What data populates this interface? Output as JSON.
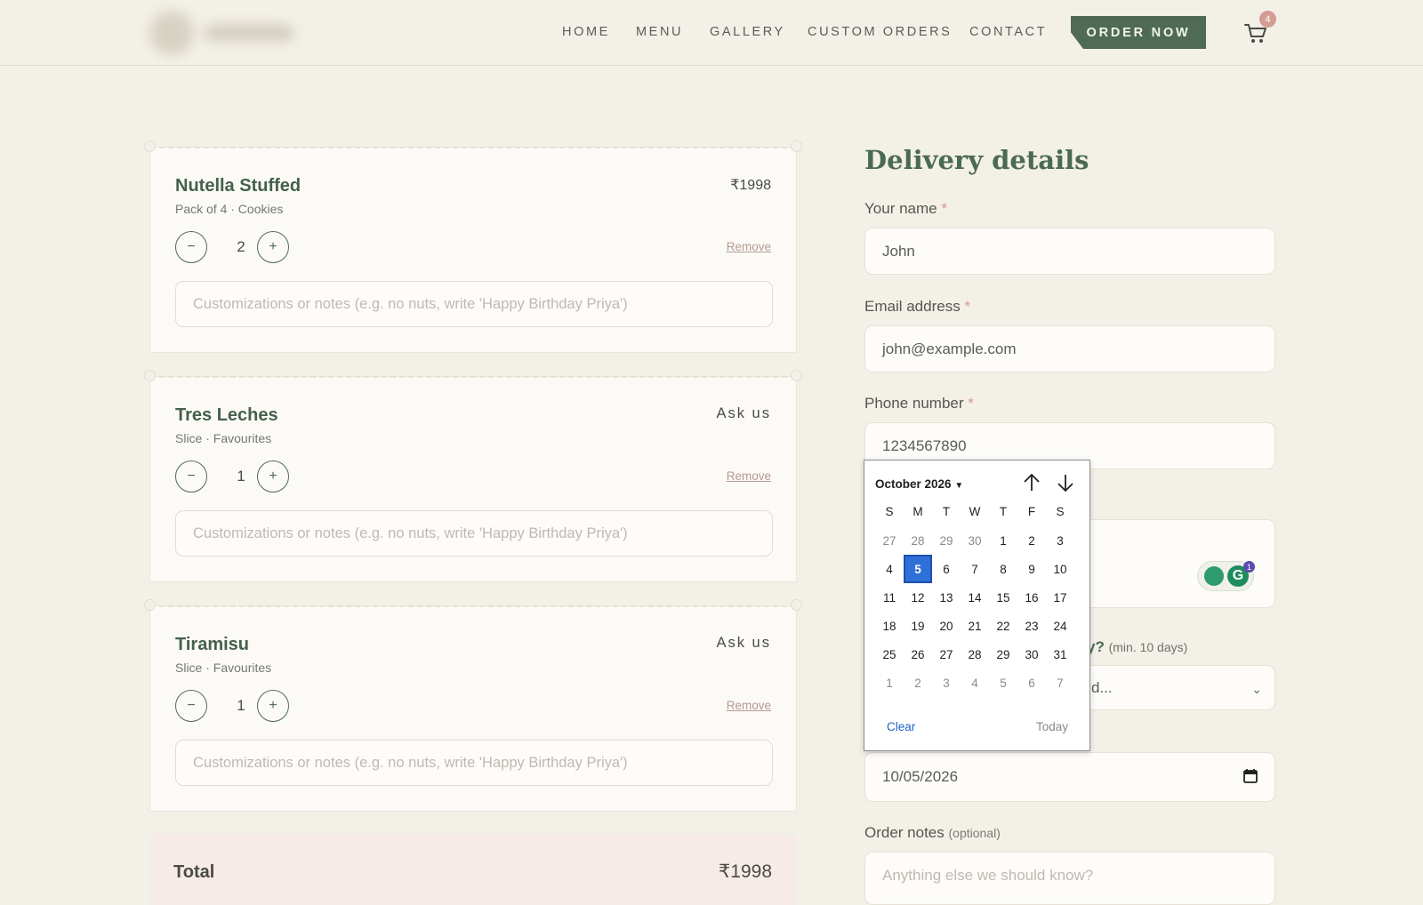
{
  "header": {
    "nav": [
      "HOME",
      "MENU",
      "GALLERY",
      "CUSTOM ORDERS",
      "CONTACT"
    ],
    "order_button": "ORDER NOW",
    "cart_count": "4",
    "accent": "#4f6b55"
  },
  "cart": {
    "items": [
      {
        "title": "Nutella Stuffed",
        "subtitle": "Pack of 4 · Cookies",
        "price": "₹1998",
        "qty": "2",
        "remove": "Remove",
        "notes_placeholder": "Customizations or notes (e.g. no nuts, write 'Happy Birthday Priya')"
      },
      {
        "title": "Tres Leches",
        "subtitle": "Slice · Favourites",
        "price": "Ask us",
        "qty": "1",
        "remove": "Remove",
        "notes_placeholder": "Customizations or notes (e.g. no nuts, write 'Happy Birthday Priya')"
      },
      {
        "title": "Tiramisu",
        "subtitle": "Slice · Favourites",
        "price": "Ask us",
        "qty": "1",
        "remove": "Remove",
        "notes_placeholder": "Customizations or notes (e.g. no nuts, write 'Happy Birthday Priya')"
      }
    ],
    "minus": "−",
    "plus": "+",
    "total_label": "Total",
    "total_value": "₹1998"
  },
  "form": {
    "heading": "Delivery details",
    "required_mark": "*",
    "name_label": "Your name",
    "name_value": "John",
    "email_label": "Email address",
    "email_value": "john@example.com",
    "phone_label": "Phone number",
    "phone_value": "1234567890",
    "grammarly_badge": "1",
    "delivery_label_tail": "y?",
    "delivery_min": "(min. 10 days)",
    "select_value_tail": "d...",
    "date_value": "10/05/2026",
    "notes_label": "Order notes",
    "notes_optional": "(optional)",
    "notes_placeholder": "Anything else we should know?"
  },
  "calendar": {
    "month_label": "October 2026",
    "weekdays": [
      "S",
      "M",
      "T",
      "W",
      "T",
      "F",
      "S"
    ],
    "weeks": [
      [
        "27",
        "28",
        "29",
        "30",
        "1",
        "2",
        "3"
      ],
      [
        "4",
        "5",
        "6",
        "7",
        "8",
        "9",
        "10"
      ],
      [
        "11",
        "12",
        "13",
        "14",
        "15",
        "16",
        "17"
      ],
      [
        "18",
        "19",
        "20",
        "21",
        "22",
        "23",
        "24"
      ],
      [
        "25",
        "26",
        "27",
        "28",
        "29",
        "30",
        "31"
      ],
      [
        "1",
        "2",
        "3",
        "4",
        "5",
        "6",
        "7"
      ]
    ],
    "selected": "5",
    "clear": "Clear",
    "today": "Today"
  }
}
